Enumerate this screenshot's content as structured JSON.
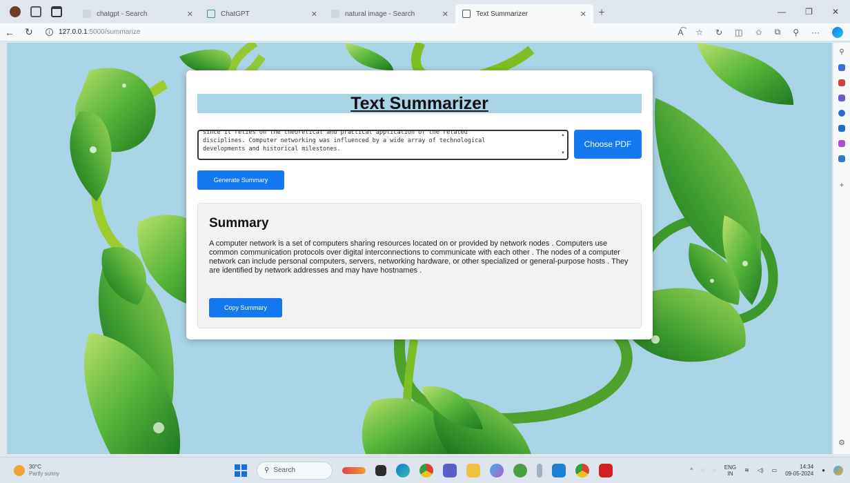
{
  "browser": {
    "tabs": [
      {
        "title": "chatgpt - Search",
        "active": false
      },
      {
        "title": "ChatGPT",
        "active": false
      },
      {
        "title": "natural image - Search",
        "active": false
      },
      {
        "title": "Text Summarizer",
        "active": true
      }
    ],
    "url_host": "127.0.0.1",
    "url_path": ":5000/summarize"
  },
  "page": {
    "title": "Text Summarizer",
    "input_text": "since it relies on the theoretical and practical application of the related\ndisciplines. Computer networking was influenced by a wide array of technological\ndevelopments and historical milestones.",
    "choose_pdf_label": "Choose PDF",
    "generate_label": "Generate Summary",
    "summary_heading": "Summary",
    "summary_text": "A computer network is a set of computers sharing resources located on or provided by network nodes . Computers use common communication protocols over digital interconnections to communicate with each other . The nodes of a computer network can include personal computers, servers, networking hardware, or other specialized or general-purpose hosts . They are identified by network addresses and may have hostnames .",
    "copy_label": "Copy Summary"
  },
  "taskbar": {
    "weather_temp": "30°C",
    "weather_desc": "Partly sunny",
    "search_placeholder": "Search",
    "lang_top": "ENG",
    "lang_bottom": "IN",
    "time": "14:34",
    "date": "09-05-2024"
  },
  "colors": {
    "accent_button": "#1479f0",
    "page_background": "#a9d4e6",
    "title_bar": "#a9d4e6"
  }
}
